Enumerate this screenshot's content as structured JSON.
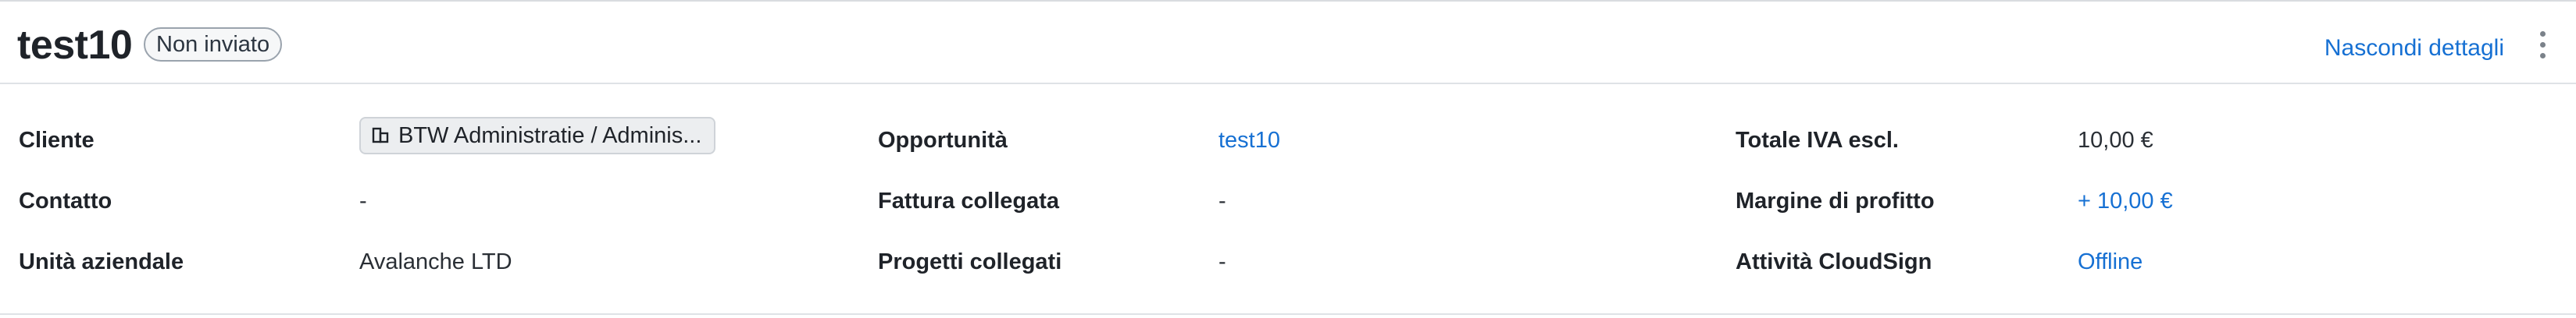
{
  "header": {
    "title": "test10",
    "status_badge": "Non inviato",
    "toggle_details_label": "Nascondi dettagli"
  },
  "details": {
    "column1": {
      "cliente_label": "Cliente",
      "cliente_value": "BTW Administratie / Adminis...",
      "cliente_icon": "building-icon",
      "contatto_label": "Contatto",
      "contatto_value": "-",
      "unita_label": "Unità aziendale",
      "unita_value": "Avalanche LTD"
    },
    "column2": {
      "opportunita_label": "Opportunità",
      "opportunita_value": "test10",
      "fattura_label": "Fattura collegata",
      "fattura_value": "-",
      "progetti_label": "Progetti collegati",
      "progetti_value": "-"
    },
    "column3": {
      "totale_label": "Totale IVA escl.",
      "totale_value": "10,00 €",
      "margine_label": "Margine di profitto",
      "margine_value": "+ 10,00 €",
      "cloudsign_label": "Attività CloudSign",
      "cloudsign_value": "Offline"
    }
  },
  "colors": {
    "link": "#1670d3",
    "text": "#1f2329",
    "border": "#dfe2e6"
  }
}
